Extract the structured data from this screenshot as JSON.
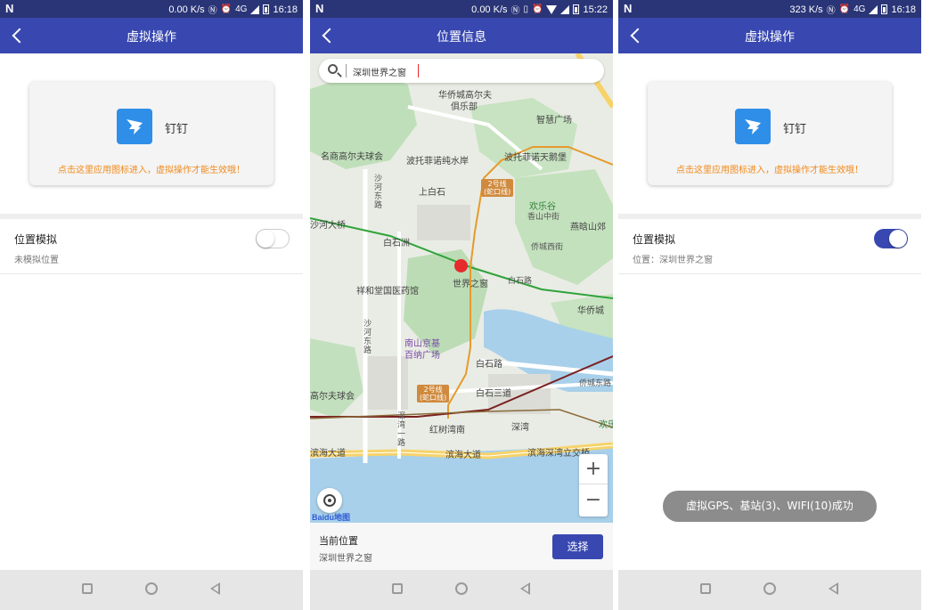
{
  "screen1": {
    "status": {
      "net": "0.00 K/s",
      "net_type": "4G",
      "time": "16:18"
    },
    "title": "虚拟操作",
    "app": {
      "name": "钉钉",
      "hint": "点击这里应用图标进入，虚拟操作才能生效哦！"
    },
    "location": {
      "title": "位置模拟",
      "subtitle": "未模拟位置",
      "enabled": false
    }
  },
  "screen2": {
    "status": {
      "net": "0.00 K/s",
      "time": "15:22"
    },
    "title": "位置信息",
    "search": {
      "value": "深圳世界之窗"
    },
    "map_labels": {
      "golf_north": "华侨城高尔夫",
      "golf_north2": "俱乐部",
      "golf_east": "名商高尔夫球会",
      "waterpark": "波托菲诺纯水岸",
      "tianehu": "波托菲诺天鹅堡",
      "plaza": "智慧广场",
      "shangbaishi": "上白石",
      "happy_valley": "欢乐谷",
      "yanqiao": "燕晗山郊",
      "bridge": "沙河大桥",
      "baishizhou": "白石洲",
      "world_window": "世界之窗",
      "xiangdongtang": "祥和堂国医药馆",
      "huacheng": "华侨城",
      "nanshan_plaza_1": "南山京基",
      "nanshan_plaza_2": "百纳广场",
      "baishi_road": "白石路",
      "baishi_3": "白石三道",
      "golf_west": "高尔夫球会",
      "hongshuwan": "红树湾南",
      "shenwan": "深湾",
      "binhai": "滨海大道",
      "binhai_2": "滨海大道",
      "binhai_interchange": "滨海深湾立交桥",
      "xiangshan": "香山中街",
      "qiaocheng_west": "侨城西街",
      "qiaocheng_east": "侨城东路",
      "baishi_road_e": "白石路",
      "shahe_east": "沙河东路",
      "shahe_east_2": "沙河东路",
      "shenwan_1": "深湾一路",
      "huanshan": "欢乐",
      "metro_line": "2号线",
      "metro_sub": "(蛇口线)"
    },
    "map_attribution": "Baidu地图",
    "current_label": "当前位置",
    "current_value": "深圳世界之窗",
    "select_label": "选择",
    "zoom_in": "+",
    "zoom_out": "−"
  },
  "screen3": {
    "status": {
      "net": "323 K/s",
      "net_type": "4G",
      "time": "16:18"
    },
    "title": "虚拟操作",
    "app": {
      "name": "钉钉",
      "hint": "点击这里应用图标进入，虚拟操作才能生效哦！"
    },
    "location": {
      "title": "位置模拟",
      "subtitle": "位置：深圳世界之窗",
      "enabled": true
    },
    "toast": "虚拟GPS、基站(3)、WIFI(10)成功"
  },
  "colors": {
    "primary": "#3848b0",
    "status_bar": "#2a3577",
    "hint": "#f08a1c",
    "pin": "#e52b2b"
  },
  "icons": [
    "back-arrow-icon",
    "dingtalk-icon",
    "search-icon",
    "locate-icon",
    "nav-square-icon",
    "nav-circle-icon",
    "nav-back-icon"
  ]
}
